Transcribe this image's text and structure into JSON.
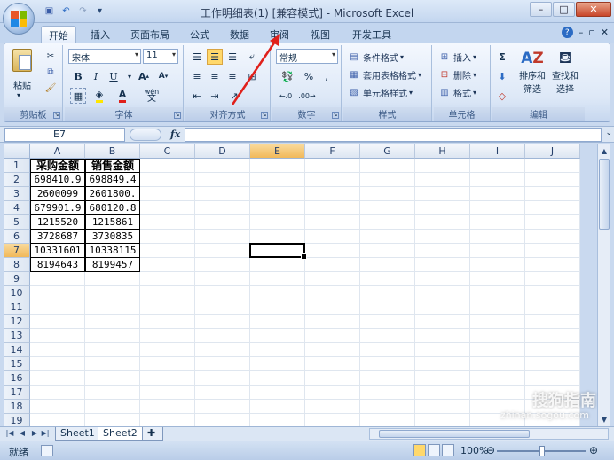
{
  "title": "工作明细表(1)  [兼容模式] - Microsoft Excel",
  "tabs": [
    {
      "label": "开始",
      "active": true
    },
    {
      "label": "插入"
    },
    {
      "label": "页面布局"
    },
    {
      "label": "公式"
    },
    {
      "label": "数据"
    },
    {
      "label": "审阅"
    },
    {
      "label": "视图"
    },
    {
      "label": "开发工具"
    }
  ],
  "ribbon": {
    "clipboard": {
      "label": "剪贴板",
      "paste": "粘贴"
    },
    "font": {
      "label": "字体",
      "font_name": "宋体",
      "font_size": "11",
      "wen": "wén",
      "wen2": "文"
    },
    "alignment": {
      "label": "对齐方式"
    },
    "number": {
      "label": "数字",
      "format": "常规"
    },
    "styles": {
      "label": "样式",
      "conditional": "条件格式",
      "table": "套用表格格式",
      "cell_style": "单元格样式"
    },
    "cells": {
      "label": "单元格",
      "insert": "插入",
      "delete": "删除",
      "format": "格式"
    },
    "editing": {
      "label": "编辑",
      "sort": "排序和",
      "sort2": "筛选",
      "find": "查找和",
      "find2": "选择"
    }
  },
  "formula_bar": {
    "name_box": "E7",
    "fx": "fx",
    "value": ""
  },
  "columns": [
    "A",
    "B",
    "C",
    "D",
    "E",
    "F",
    "G",
    "H",
    "I",
    "J"
  ],
  "rows": [
    "1",
    "2",
    "3",
    "4",
    "5",
    "6",
    "7",
    "8",
    "9",
    "10",
    "11",
    "12",
    "13",
    "14",
    "15",
    "16",
    "17",
    "18",
    "19"
  ],
  "cells": {
    "A1": "采购金额",
    "B1": "销售金额",
    "A2": "698410.9",
    "B2": "698849.4",
    "A3": "2600099",
    "B3": "2601800.",
    "A4": "679901.9",
    "B4": "680120.8",
    "A5": "1215520",
    "B5": "1215861",
    "A6": "3728687",
    "B6": "3730835",
    "A7": "10331601",
    "B7": "10338115",
    "A8": "8194643",
    "B8": "8199457"
  },
  "active_cell": "E7",
  "sheets": [
    {
      "label": "Sheet1"
    },
    {
      "label": "Sheet2",
      "active": true
    }
  ],
  "status": {
    "ready": "就绪",
    "zoom": "100%"
  },
  "watermark": {
    "brand": "搜狗指南",
    "url": "zhinan.sogou.com"
  },
  "colors": {
    "accent": "#e0201b",
    "selection_header": "#f1b95a"
  }
}
